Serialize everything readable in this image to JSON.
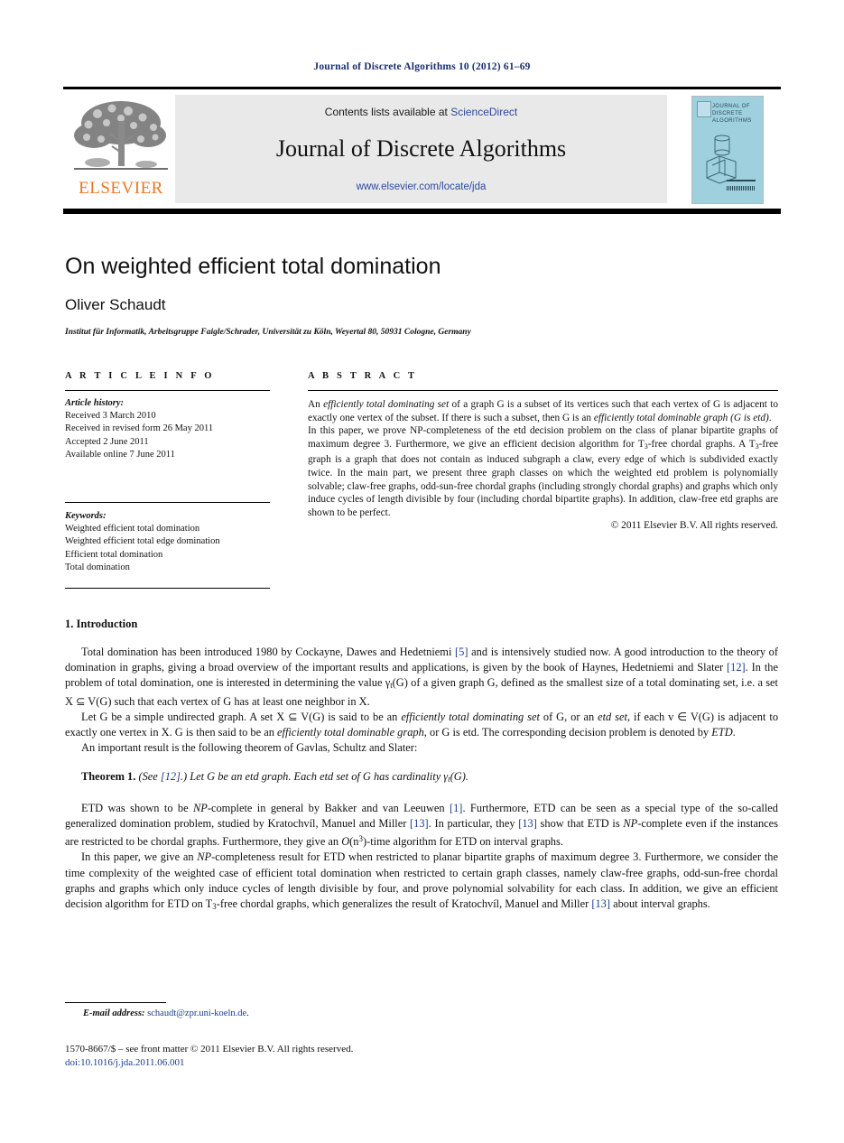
{
  "running_head": "Journal of Discrete Algorithms 10 (2012) 61–69",
  "masthead": {
    "contents_prefix": "Contents lists available at ",
    "sciencedirect": "ScienceDirect",
    "journal_name": "Journal of Discrete Algorithms",
    "journal_url": "www.elsevier.com/locate/jda",
    "publisher_wordmark": "ELSEVIER",
    "cover_title": "JOURNAL OF DISCRETE ALGORITHMS"
  },
  "article": {
    "title": "On weighted efficient total domination",
    "author": "Oliver Schaudt",
    "affiliation": "Institut für Informatik, Arbeitsgruppe Faigle/Schrader, Universität zu Köln, Weyertal 80, 50931 Cologne, Germany"
  },
  "info": {
    "header": "A R T I C L E   I N F O",
    "history_label": "Article history:",
    "history": [
      "Received 3 March 2010",
      "Received in revised form 26 May 2011",
      "Accepted 2 June 2011",
      "Available online 7 June 2011"
    ],
    "keywords_label": "Keywords:",
    "keywords": [
      "Weighted efficient total domination",
      "Weighted efficient total edge domination",
      "Efficient total domination",
      "Total domination"
    ]
  },
  "abstract": {
    "header": "A B S T R A C T",
    "para1_a": "An ",
    "para1_i1": "efficiently total dominating set",
    "para1_b": " of a graph G is a subset of its vertices such that each vertex of G is adjacent to exactly one vertex of the subset. If there is such a subset, then G is an ",
    "para1_i2": "efficiently total dominable graph (G is etd)",
    "para1_c": ".",
    "para2_a": "In this paper, we prove NP-completeness of the etd decision problem on the class of planar bipartite graphs of maximum degree 3. Furthermore, we give an efficient decision algorithm for T",
    "para2_sub1": "3",
    "para2_b": "-free chordal graphs. A T",
    "para2_sub2": "3",
    "para2_c": "-free graph is a graph that does not contain as induced subgraph a claw, every edge of which is subdivided exactly twice. In the main part, we present three graph classes on which the weighted etd problem is polynomially solvable; claw-free graphs, odd-sun-free chordal graphs (including strongly chordal graphs) and graphs which only induce cycles of length divisible by four (including chordal bipartite graphs). In addition, claw-free etd graphs are shown to be perfect.",
    "copyright": "© 2011 Elsevier B.V. All rights reserved."
  },
  "body": {
    "section_title": "1. Introduction",
    "p1_a": "Total domination has been introduced 1980 by Cockayne, Dawes and Hedetniemi ",
    "p1_cite1": "[5]",
    "p1_b": " and is intensively studied now. A good introduction to the theory of domination in graphs, giving a broad overview of the important results and applications, is given by the book of Haynes, Hedetniemi and Slater ",
    "p1_cite2": "[12]",
    "p1_c": ". In the problem of total domination, one is interested in determining the value γ",
    "p1_sub": "t",
    "p1_d": "(G) of a given graph G, defined as the smallest size of a total dominating set, i.e. a set X ⊆ V(G) such that each vertex of G has at least one neighbor in X.",
    "p2_a": "Let G be a simple undirected graph. A set X ⊆ V(G) is said to be an ",
    "p2_i1": "efficiently total dominating set",
    "p2_b": " of G, or an ",
    "p2_i2": "etd set",
    "p2_c": ", if each v ∈ V(G) is adjacent to exactly one vertex in X. G is then said to be an ",
    "p2_i3": "efficiently total dominable graph",
    "p2_d": ", or G is etd. The corresponding decision problem is denoted by ",
    "p2_i4": "ETD",
    "p2_e": ".",
    "p3": "An important result is the following theorem of Gavlas, Schultz and Slater:",
    "thm_label": "Theorem 1.",
    "thm_see_a": " (See ",
    "thm_cite": "[12]",
    "thm_see_b": ".) Let G be an etd graph. Each etd set of G has cardinality γ",
    "thm_sub": "t",
    "thm_see_c": "(G).",
    "p4_a": "ETD was shown to be ",
    "p4_np1": "NP",
    "p4_b": "-complete in general by Bakker and van Leeuwen ",
    "p4_cite1": "[1]",
    "p4_c": ". Furthermore, ETD can be seen as a special type of the so-called generalized domination problem, studied by Kratochvíl, Manuel and Miller ",
    "p4_cite2": "[13]",
    "p4_d": ". In particular, they ",
    "p4_cite3": "[13]",
    "p4_e": " show that ETD is ",
    "p4_np2": "NP",
    "p4_f": "-complete even if the instances are restricted to be chordal graphs. Furthermore, they give an ",
    "p4_o": "O",
    "p4_g": "(n",
    "p4_sup": "3",
    "p4_h": ")-time algorithm for ETD on interval graphs.",
    "p5_a": "In this paper, we give an ",
    "p5_np": "NP",
    "p5_b": "-completeness result for ETD when restricted to planar bipartite graphs of maximum degree 3. Furthermore, we consider the time complexity of the weighted case of efficient total domination when restricted to certain graph classes, namely claw-free graphs, odd-sun-free chordal graphs and graphs which only induce cycles of length divisible by four, and prove polynomial solvability for each class. In addition, we give an efficient decision algorithm for ETD on T",
    "p5_sub": "3",
    "p5_c": "-free chordal graphs, which generalizes the result of Kratochvíl, Manuel and Miller ",
    "p5_cite": "[13]",
    "p5_d": " about interval graphs."
  },
  "footer": {
    "email_label": "E-mail address:",
    "email": "schaudt@zpr.uni-koeln.de",
    "email_suffix": ".",
    "imprint": "1570-8667/$ – see front matter © 2011 Elsevier B.V. All rights reserved.",
    "doi": "doi:10.1016/j.jda.2011.06.001"
  }
}
